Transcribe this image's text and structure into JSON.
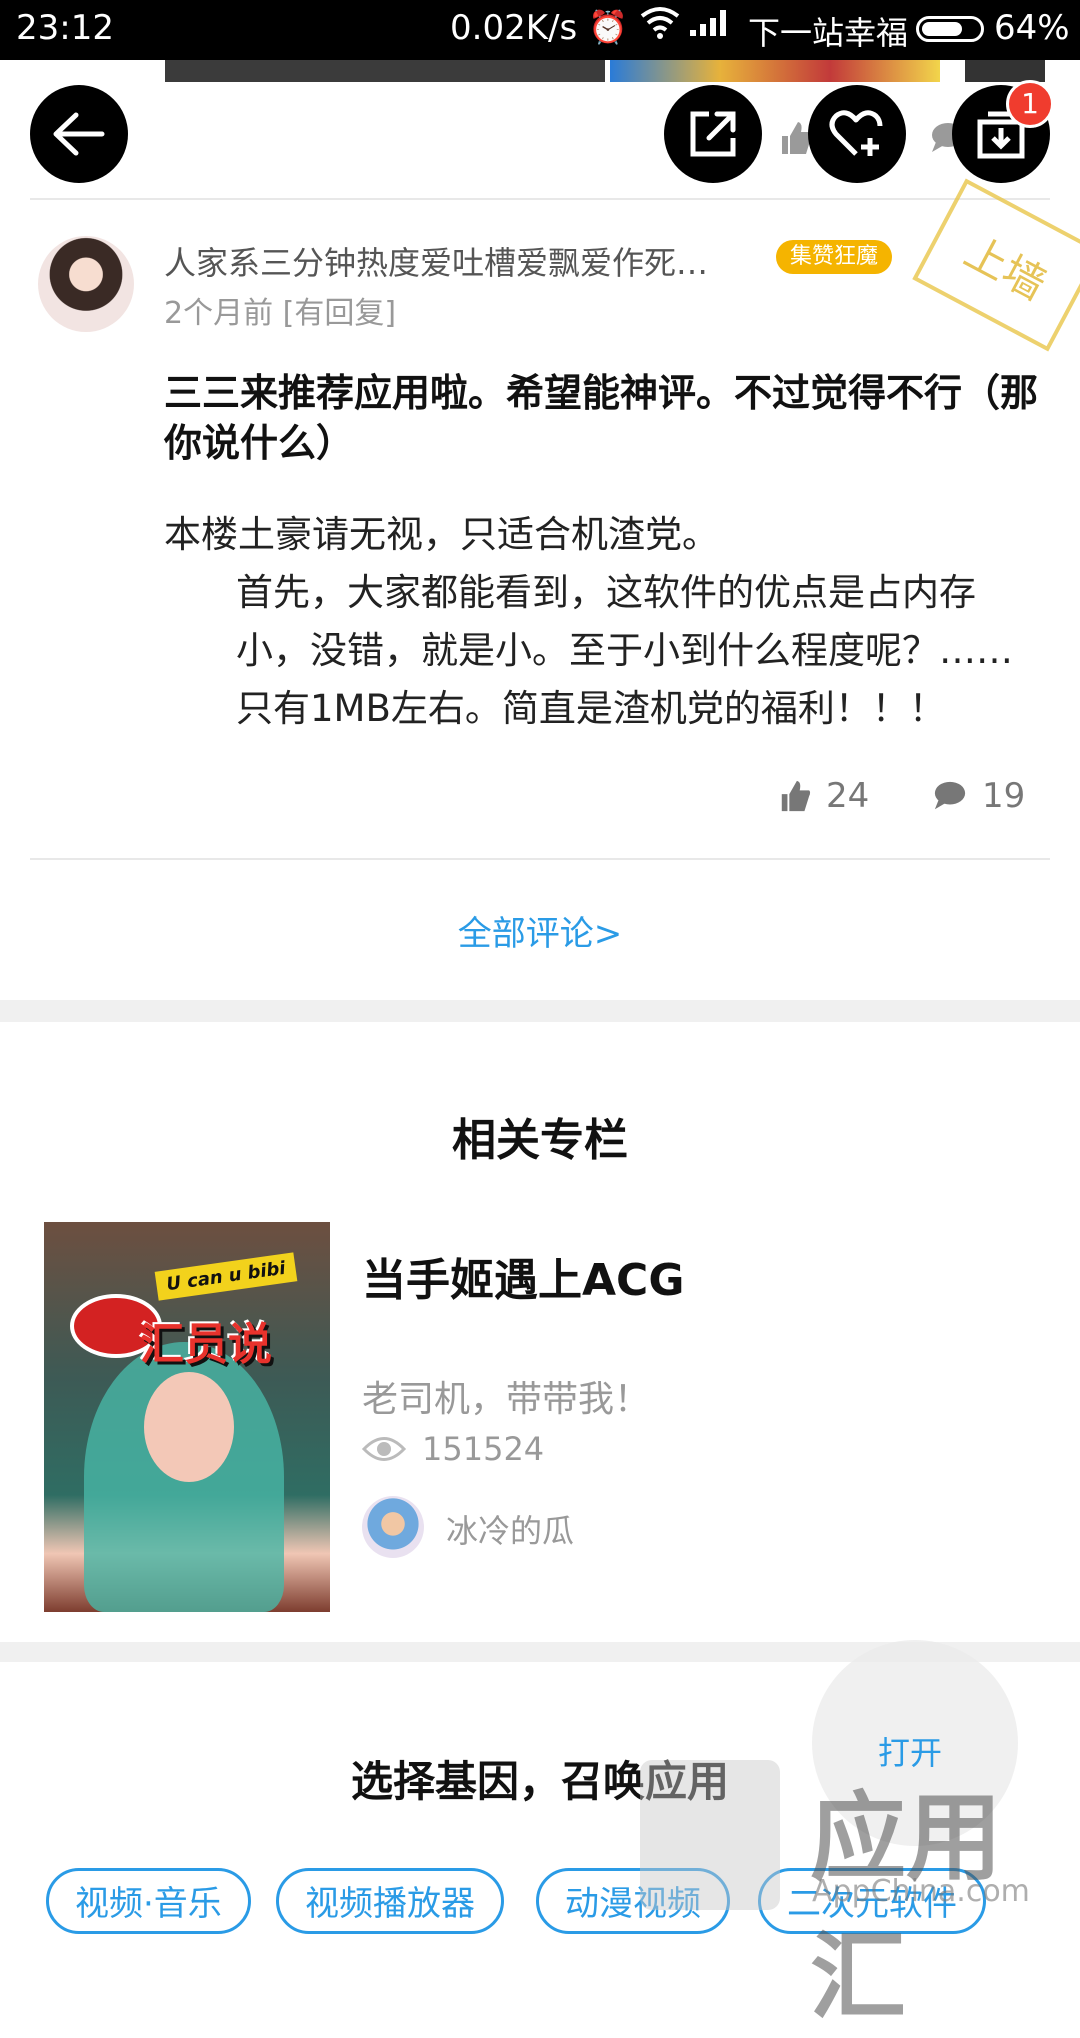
{
  "status_bar": {
    "time": "23:12",
    "network_speed": "0.02K/s",
    "carrier": "下一站幸福",
    "battery": "64%",
    "battery_level": 0.64
  },
  "top_actions": {
    "download_badge": "1"
  },
  "review": {
    "username": "人家系三分钟热度爱吐槽爱飘爱作死…",
    "level_badge": "集赞狂魔",
    "meta": "2个月前 [有回复]",
    "stamp": "上墙",
    "title": "三三来推荐应用啦。希望能神评。不过觉得不行（那你说什么）",
    "body_line1": "本楼土豪请无视，只适合机渣党。",
    "body_line2": "首先，大家都能看到，这软件的优点是占内存小，没错，就是小。至于小到什么程度呢？……只有1MB左右。简直是渣机党的福利！！！",
    "likes": "24",
    "comments": "19"
  },
  "all_comments_link": "全部评论>",
  "related_column": {
    "section_title": "相关专栏",
    "cover_tag": "U can u bibi",
    "cover_logo": "汇员说",
    "title": "当手姬遇上ACG",
    "description": "老司机，带带我！",
    "views": "151524",
    "author": "冰冷的瓜"
  },
  "gene_section": {
    "title": "选择基因，召唤应用",
    "tags": [
      "视频·音乐",
      "视频播放器",
      "动漫视频",
      "二次元软件"
    ]
  },
  "floating": {
    "open_label": "打开",
    "watermark": "应用汇",
    "watermark_sub": "AppChina.com"
  },
  "colors": {
    "accent": "#2a9be6",
    "badge_red": "#f03c2e",
    "level_badge": "#f5b400"
  }
}
